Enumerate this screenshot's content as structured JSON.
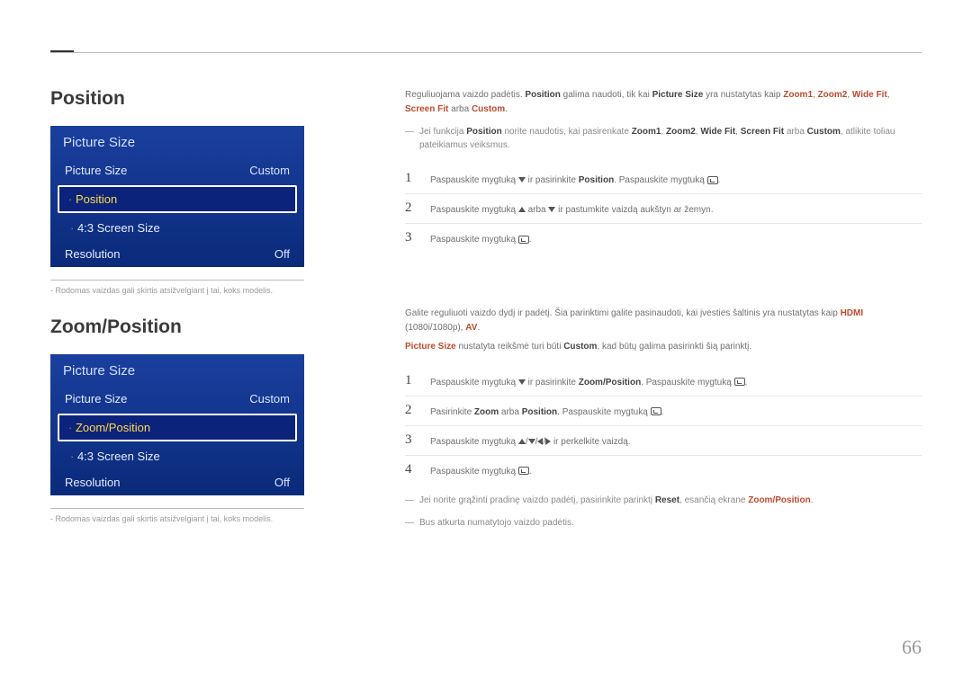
{
  "page_number": "66",
  "section1": {
    "heading": "Position",
    "panel": {
      "title": "Picture Size",
      "row1_label": "Picture Size",
      "row1_value": "Custom",
      "selected": "Position",
      "sub1": "4:3 Screen Size",
      "row2_label": "Resolution",
      "row2_value": "Off"
    },
    "footnote": "Rodomas vaizdas gali skirtis atsižvelgiant į tai, koks modelis.",
    "intro_plain1": "Reguliuojama vaizdo padėtis. ",
    "intro_bold1": "Position",
    "intro_plain2": " galima naudoti, tik kai ",
    "intro_bold2": "Picture Size",
    "intro_plain3": " yra nustatytas kaip ",
    "intro_red1": "Zoom1",
    "intro_red2": "Zoom2",
    "intro_red3": "Wide Fit",
    "intro_red4": "Screen Fit",
    "intro_plain4": " arba ",
    "intro_red5": "Custom",
    "note_pre": "Jei funkcija ",
    "note_b1": "Position",
    "note_mid1": " norite naudotis, kai pasirenkate ",
    "note_b2": "Zoom1",
    "note_b3": "Zoom2",
    "note_b4": "Wide Fit",
    "note_b5": "Screen Fit",
    "note_mid2": " arba ",
    "note_b6": "Custom",
    "note_tail": ", atlikite toliau pateikiamus veiksmus.",
    "steps": {
      "s1a": "Paspauskite mygtuką ",
      "s1b": " ir pasirinkite ",
      "s1_bold": "Position",
      "s1c": ". Paspauskite mygtuką ",
      "s2a": "Paspauskite mygtuką ",
      "s2b": " arba ",
      "s2c": " ir pastumkite vaizdą aukštyn ar žemyn.",
      "s3a": "Paspauskite mygtuką "
    }
  },
  "section2": {
    "heading": "Zoom/Position",
    "panel": {
      "title": "Picture Size",
      "row1_label": "Picture Size",
      "row1_value": "Custom",
      "selected": "Zoom/Position",
      "sub1": "4:3 Screen Size",
      "row2_label": "Resolution",
      "row2_value": "Off"
    },
    "footnote": "Rodomas vaizdas gali skirtis atsižvelgiant į tai, koks modelis.",
    "intro_a": "Galite reguliuoti vaizdo dydį ir padėtį. Šia parinktimi galite pasinaudoti, kai įvesties šaltinis yra nustatytas kaip ",
    "intro_red1": "HDMI",
    "intro_b": " (1080i/1080p), ",
    "intro_red2": "AV",
    "line2_red": "Picture Size",
    "line2_mid": " nustatyta reikšmė turi būti ",
    "line2_bold": "Custom",
    "line2_tail": ", kad būtų galima pasirinkti šią parinktį.",
    "steps": {
      "s1a": "Paspauskite mygtuką ",
      "s1b": " ir pasirinkite ",
      "s1_bold": "Zoom/Position",
      "s1c": ". Paspauskite mygtuką ",
      "s2a": "Pasirinkite ",
      "s2_bold1": "Zoom",
      "s2b": " arba ",
      "s2_bold2": "Position",
      "s2c": ". Paspauskite mygtuką ",
      "s3a": "Paspauskite mygtuką ",
      "s3b": " ir perkelkite vaizdą.",
      "s4a": "Paspauskite mygtuką "
    },
    "note1_a": "Jei norite grąžinti pradinę vaizdo padėtį, pasirinkite parinktį ",
    "note1_bold": "Reset",
    "note1_b": ", esančią ekrane ",
    "note1_red": "Zoom/Position",
    "note2": "Bus atkurta numatytojo vaizdo padėtis."
  }
}
